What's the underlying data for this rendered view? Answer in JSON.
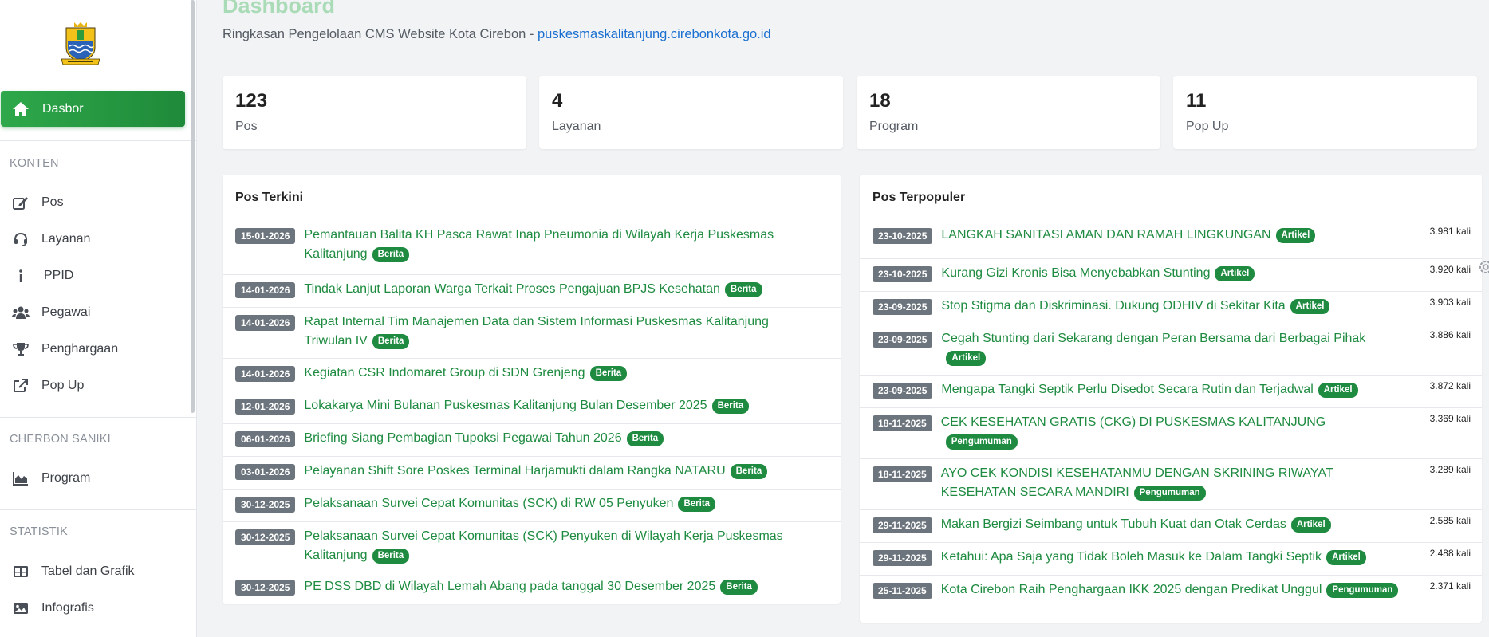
{
  "colors": {
    "primary": "#1e8b40",
    "badge_gray": "#6c757d",
    "link": "#1a6fd1"
  },
  "sidebar": {
    "logo_icon": "kota-cirebon-crest-icon",
    "active_item": {
      "label": "Dasbor",
      "icon": "home-icon"
    },
    "sections": [
      {
        "title": "KONTEN",
        "items": [
          {
            "label": "Pos",
            "icon": "edit-icon"
          },
          {
            "label": "Layanan",
            "icon": "headset-icon"
          },
          {
            "label": "PPID",
            "icon": "info-icon"
          },
          {
            "label": "Pegawai",
            "icon": "users-icon"
          },
          {
            "label": "Penghargaan",
            "icon": "trophy-icon"
          },
          {
            "label": "Pop Up",
            "icon": "external-link-icon"
          }
        ]
      },
      {
        "title": "CHERBON SANIKI",
        "items": [
          {
            "label": "Program",
            "icon": "chart-area-icon"
          }
        ]
      },
      {
        "title": "STATISTIK",
        "items": [
          {
            "label": "Tabel dan Grafik",
            "icon": "table-icon"
          },
          {
            "label": "Infografis",
            "icon": "image-icon"
          }
        ]
      }
    ]
  },
  "header": {
    "title": "Dashboard",
    "subtitle": "Ringkasan Pengelolaan CMS Website Kota Cirebon - ",
    "domain": "puskesmaskalitanjung.cirebonkota.go.id"
  },
  "stats": [
    {
      "value": "123",
      "label": "Pos"
    },
    {
      "value": "4",
      "label": "Layanan"
    },
    {
      "value": "18",
      "label": "Program"
    },
    {
      "value": "11",
      "label": "Pop Up"
    }
  ],
  "recent_posts": {
    "title": "Pos Terkini",
    "items": [
      {
        "date": "15-01-2026",
        "title": "Pemantauan Balita KH Pasca Rawat Inap Pneumonia di Wilayah Kerja Puskesmas Kalitanjung",
        "category": "Berita"
      },
      {
        "date": "14-01-2026",
        "title": "Tindak Lanjut Laporan Warga Terkait Proses Pengajuan BPJS Kesehatan",
        "category": "Berita"
      },
      {
        "date": "14-01-2026",
        "title": "Rapat Internal Tim Manajemen Data dan Sistem Informasi Puskesmas Kalitanjung Triwulan IV",
        "category": "Berita"
      },
      {
        "date": "14-01-2026",
        "title": "Kegiatan CSR Indomaret Group di SDN Grenjeng",
        "category": "Berita"
      },
      {
        "date": "12-01-2026",
        "title": "Lokakarya Mini Bulanan Puskesmas Kalitanjung Bulan Desember 2025",
        "category": "Berita"
      },
      {
        "date": "06-01-2026",
        "title": "Briefing Siang Pembagian Tupoksi Pegawai Tahun 2026",
        "category": "Berita"
      },
      {
        "date": "03-01-2026",
        "title": "Pelayanan Shift Sore Poskes Terminal Harjamukti dalam Rangka NATARU",
        "category": "Berita"
      },
      {
        "date": "30-12-2025",
        "title": "Pelaksanaan Survei Cepat Komunitas (SCK) di RW 05 Penyuken",
        "category": "Berita"
      },
      {
        "date": "30-12-2025",
        "title": "Pelaksanaan Survei Cepat Komunitas (SCK) Penyuken di Wilayah Kerja Puskesmas Kalitanjung",
        "category": "Berita"
      },
      {
        "date": "30-12-2025",
        "title": "PE DSS DBD di Wilayah Lemah Abang pada tanggal 30 Desember 2025",
        "category": "Berita"
      }
    ]
  },
  "popular_posts": {
    "title": "Pos Terpopuler",
    "items": [
      {
        "date": "23-10-2025",
        "title": "LANGKAH SANITASI AMAN DAN RAMAH LINGKUNGAN",
        "category": "Artikel",
        "views": "3.981 kali"
      },
      {
        "date": "23-10-2025",
        "title": "Kurang Gizi Kronis Bisa Menyebabkan Stunting",
        "category": "Artikel",
        "views": "3.920 kali"
      },
      {
        "date": "23-09-2025",
        "title": "Stop Stigma dan Diskriminasi. Dukung ODHIV di Sekitar Kita",
        "category": "Artikel",
        "views": "3.903 kali"
      },
      {
        "date": "23-09-2025",
        "title": "Cegah Stunting dari Sekarang dengan Peran Bersama dari Berbagai Pihak",
        "category": "Artikel",
        "views": "3.886 kali"
      },
      {
        "date": "23-09-2025",
        "title": "Mengapa Tangki Septik Perlu Disedot Secara Rutin dan Terjadwal",
        "category": "Artikel",
        "views": "3.872 kali"
      },
      {
        "date": "18-11-2025",
        "title": "CEK KESEHATAN GRATIS (CKG) DI PUSKESMAS KALITANJUNG",
        "category": "Pengumuman",
        "views": "3.369 kali"
      },
      {
        "date": "18-11-2025",
        "title": "AYO CEK KONDISI KESEHATANMU DENGAN SKRINING RIWAYAT KESEHATAN SECARA MANDIRI",
        "category": "Pengumuman",
        "views": "3.289 kali"
      },
      {
        "date": "29-11-2025",
        "title": "Makan Bergizi Seimbang untuk Tubuh Kuat dan Otak Cerdas",
        "category": "Artikel",
        "views": "2.585 kali"
      },
      {
        "date": "29-11-2025",
        "title": "Ketahui: Apa Saja yang Tidak Boleh Masuk ke Dalam Tangki Septik",
        "category": "Artikel",
        "views": "2.488 kali"
      },
      {
        "date": "25-11-2025",
        "title": "Kota Cirebon Raih Penghargaan IKK 2025 dengan Predikat Unggul",
        "category": "Pengumuman",
        "views": "2.371 kali"
      }
    ]
  },
  "settings_icon": "gear-icon"
}
